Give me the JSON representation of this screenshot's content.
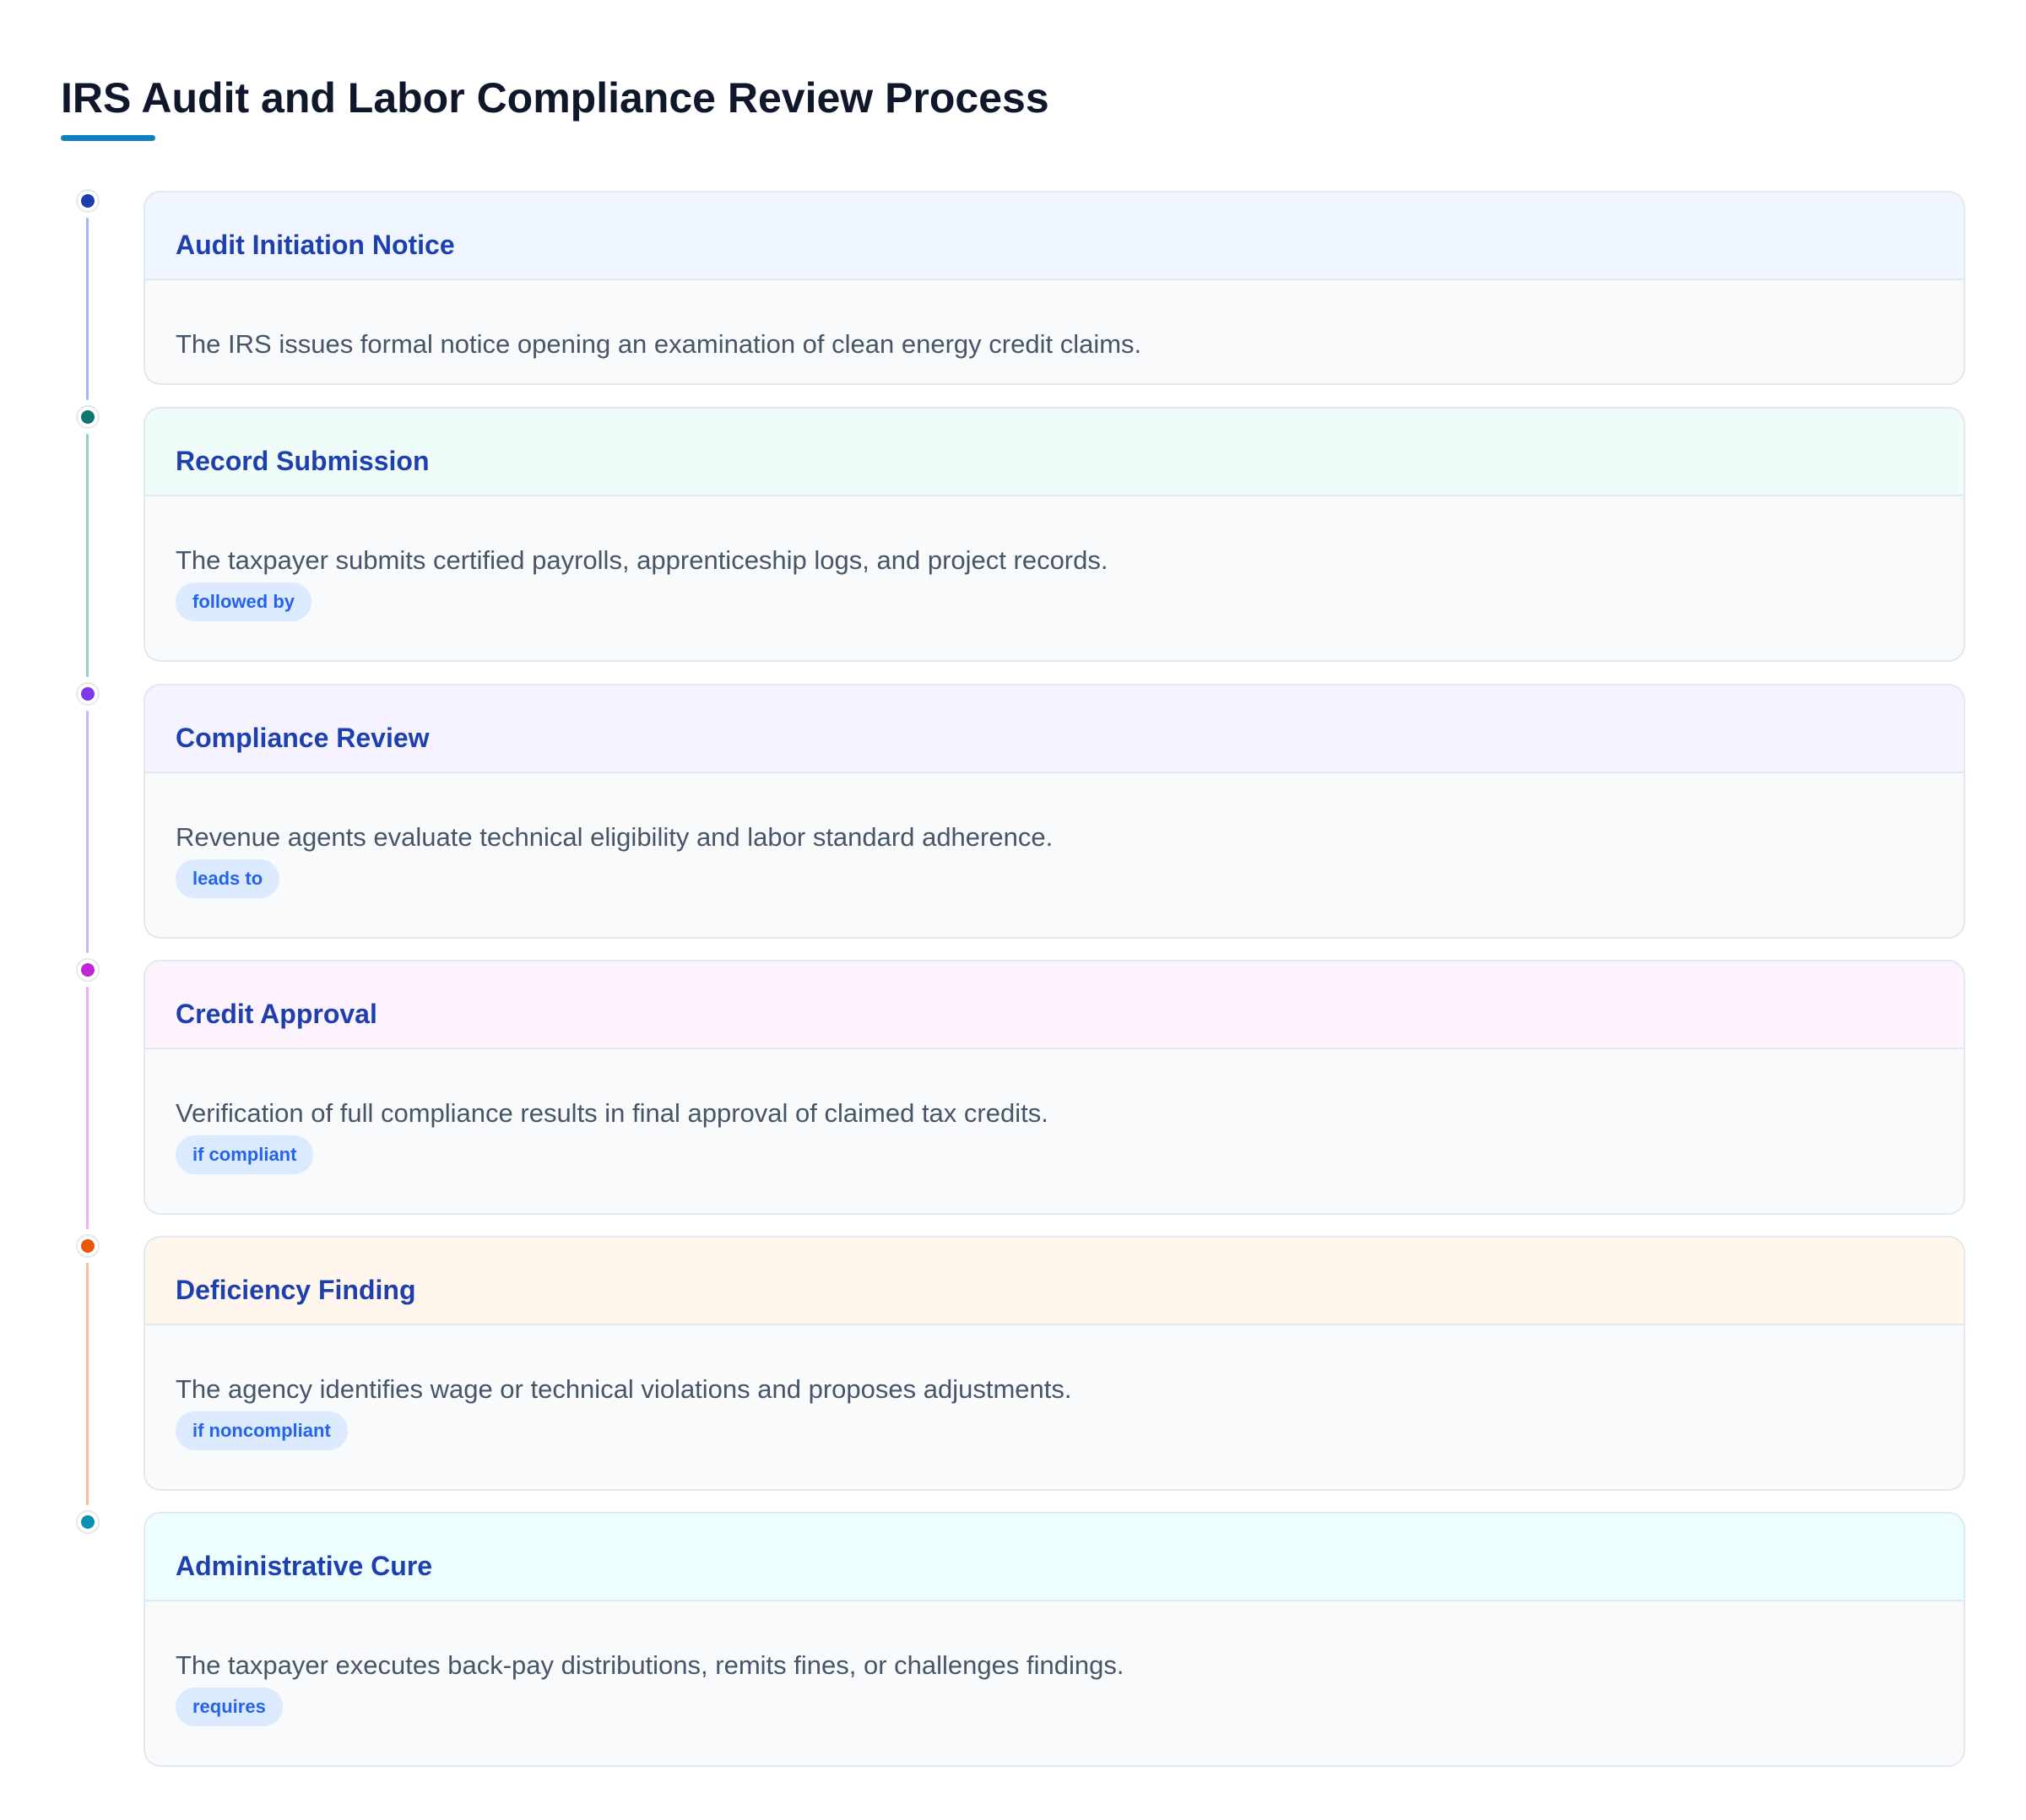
{
  "title": "IRS Audit and Labor Compliance Review Process",
  "accent_color": "#0e7fc1",
  "steps": [
    {
      "title": "Audit Initiation Notice",
      "description": "The IRS issues formal notice opening an examination of clean energy credit claims.",
      "relation": "",
      "dot_color": "#1e40af",
      "line_color": "#a5b4fc",
      "header_bg": "#eff6ff"
    },
    {
      "title": "Record Submission",
      "description": "The taxpayer submits certified payrolls, apprenticeship logs, and project records.",
      "relation": "followed by",
      "dot_color": "#0f766e",
      "line_color": "#99ccc4",
      "header_bg": "#effcf9"
    },
    {
      "title": "Compliance Review",
      "description": "Revenue agents evaluate technical eligibility and labor standard adherence.",
      "relation": "leads to",
      "dot_color": "#7c3aed",
      "line_color": "#c4b5fd",
      "header_bg": "#f5f3ff"
    },
    {
      "title": "Credit Approval",
      "description": "Verification of full compliance results in final approval of claimed tax credits.",
      "relation": "if compliant",
      "dot_color": "#c026d3",
      "line_color": "#f0abfc",
      "header_bg": "#fdf4ff"
    },
    {
      "title": "Deficiency Finding",
      "description": "The agency identifies wage or technical violations and proposes adjustments.",
      "relation": "if noncompliant",
      "dot_color": "#ea580c",
      "line_color": "#fdba9a",
      "header_bg": "#fff7ed"
    },
    {
      "title": "Administrative Cure",
      "description": "The taxpayer executes back-pay distributions, remits fines, or challenges findings.",
      "relation": "requires",
      "dot_color": "#0891b2",
      "line_color": "",
      "header_bg": "#ecfeff"
    }
  ]
}
